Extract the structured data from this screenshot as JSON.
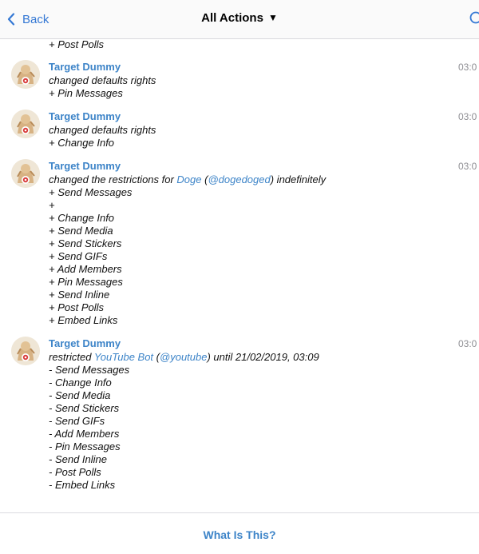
{
  "nav": {
    "back_label": "Back",
    "title": "All Actions",
    "caret": "▼"
  },
  "colors": {
    "accent": "#3d84c8",
    "timestamp": "#8e8e93"
  },
  "top_fragment": "+ Post Polls",
  "entries": [
    {
      "author": "Target Dummy",
      "time": "03:0",
      "lines": [
        "changed defaults rights",
        "+ Pin Messages"
      ]
    },
    {
      "author": "Target Dummy",
      "time": "03:0",
      "lines": [
        "changed defaults rights",
        "+ Change Info"
      ]
    },
    {
      "author": "Target Dummy",
      "time": "03:0",
      "header": {
        "prefix": "changed the restrictions for ",
        "user_name": "Doge",
        "open": " (",
        "user_handle": "@dogedoged",
        "suffix": ") indefinitely"
      },
      "lines": [
        "+ Send Messages",
        "+",
        "+ Change Info",
        "+ Send Media",
        "+ Send Stickers",
        "+ Send GIFs",
        "+ Add Members",
        "+ Pin Messages",
        "+ Send Inline",
        "+ Post Polls",
        "+ Embed Links"
      ]
    },
    {
      "author": "Target Dummy",
      "time": "03:0",
      "header": {
        "prefix": "restricted ",
        "user_name": "YouTube Bot",
        "open": " (",
        "user_handle": "@youtube",
        "suffix": ") until 21/02/2019, 03:09"
      },
      "lines": [
        "- Send Messages",
        "- Change Info",
        "- Send Media",
        "- Send Stickers",
        "- Send GIFs",
        "- Add Members",
        "- Pin Messages",
        "- Send Inline",
        "- Post Polls",
        "- Embed Links"
      ]
    }
  ],
  "footer": {
    "label": "What Is This?"
  }
}
